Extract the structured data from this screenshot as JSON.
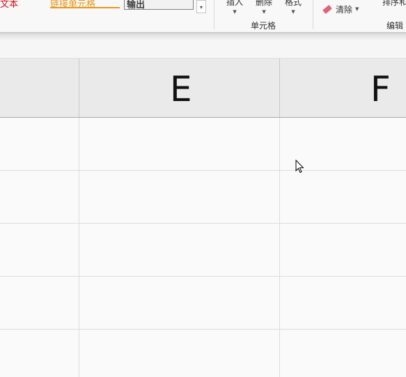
{
  "ribbon": {
    "styles": {
      "text_style": "文本",
      "linked_cell": "链接单元格",
      "output": "输出",
      "more_icon": "gallery-more-icon"
    },
    "cells_group": {
      "insert": "插入",
      "delete": "删除",
      "format": "格式",
      "label": "单元格"
    },
    "editing_group": {
      "clear": "清除",
      "sort_filter": "排序和",
      "label": "编辑",
      "clear_icon": "eraser-icon"
    }
  },
  "sheet": {
    "columns": [
      {
        "label": "E"
      },
      {
        "label": "F"
      }
    ]
  },
  "colors": {
    "text_style": "#d0121a",
    "linked_cell": "#e8971a",
    "eraser": "#e06478"
  }
}
